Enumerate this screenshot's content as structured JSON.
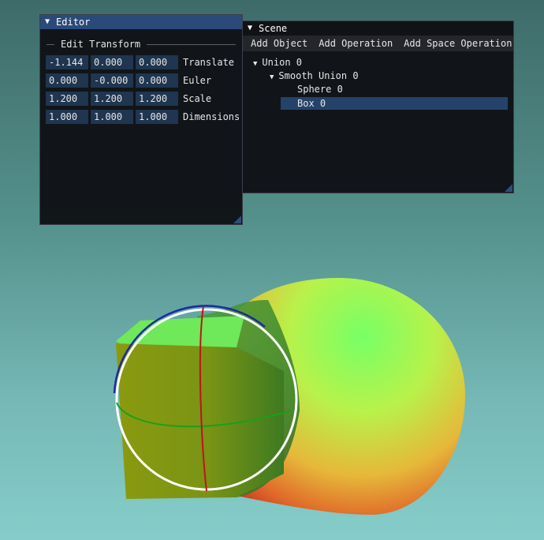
{
  "editor": {
    "title": "Editor",
    "section_label": "Edit Transform",
    "rows": [
      {
        "label": "Translate",
        "values": [
          "-1.144",
          "0.000",
          "0.000"
        ]
      },
      {
        "label": "Euler",
        "values": [
          "0.000",
          "-0.000",
          "0.000"
        ]
      },
      {
        "label": "Scale",
        "values": [
          "1.200",
          "1.200",
          "1.200"
        ]
      },
      {
        "label": "Dimensions",
        "values": [
          "1.000",
          "1.000",
          "1.000"
        ]
      }
    ]
  },
  "scene": {
    "title": "Scene",
    "menu": [
      "Add Object",
      "Add Operation",
      "Add Space Operation"
    ],
    "tree": [
      {
        "label": "Union 0",
        "expanded": true,
        "depth": 0,
        "selected": false
      },
      {
        "label": "Smooth Union 0",
        "expanded": true,
        "depth": 1,
        "selected": false
      },
      {
        "label": "Sphere 0",
        "expanded": false,
        "depth": 2,
        "selected": false
      },
      {
        "label": "Box 0",
        "expanded": false,
        "depth": 2,
        "selected": true
      }
    ]
  },
  "icons": {
    "collapse": "collapse-triangle-icon",
    "expand": "expand-triangle-icon",
    "resize": "resize-grip-icon"
  },
  "colors": {
    "editor_titlebar": "#2a4a7a",
    "field_bg": "#1f3550",
    "selection": "#25426a",
    "gizmo_x": "#c0141a",
    "gizmo_y": "#1aa01a",
    "gizmo_z": "#1a2aa0",
    "gizmo_outer": "#ffffff"
  }
}
